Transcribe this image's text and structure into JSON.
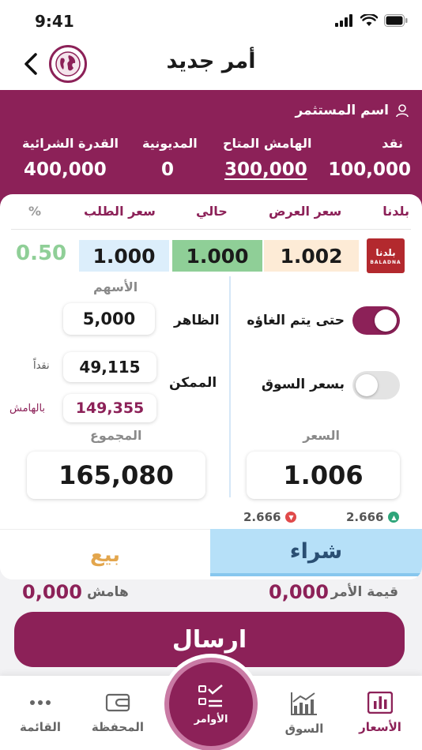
{
  "status_bar": {
    "time": "9:41"
  },
  "header": {
    "title": "أمر جديد"
  },
  "investor": {
    "name_label": "اسم المستثمر",
    "cash_label": "نقد",
    "cash_value": "100,000",
    "margin_available_label": "الهامش المتاح",
    "margin_available_value": "300,000",
    "debt_label": "المديونية",
    "debt_value": "0",
    "purchasing_power_label": "القدرة الشرائية",
    "purchasing_power_value": "400,000"
  },
  "quote": {
    "columns": {
      "stock": "بلدنا",
      "ask": "سعر العرض",
      "current": "حالي",
      "bid": "سعر الطلب",
      "percent": "%"
    },
    "stock_logo_ar": "بلدنا",
    "stock_logo_en": "BALADNA",
    "ask_price": "1.002",
    "current_price": "1.000",
    "bid_price": "1.000",
    "change_percent": "0.50"
  },
  "order": {
    "until_cancel_label": "حتى يتم الغاؤه",
    "until_cancel_on": true,
    "market_price_label": "بسعر السوق",
    "market_price_on": false,
    "price_label": "السعر",
    "price_value": "1.006",
    "shares_label": "الأسهم",
    "visible_label": "الظاهر",
    "visible_value": "5,000",
    "possible_label": "الممكن",
    "cash_short_label": "نقداً",
    "possible_cash_value": "49,115",
    "margin_short_label": "بالهامش",
    "possible_margin_value": "149,355",
    "total_label": "المجموع",
    "total_value": "165,080",
    "range_up": "2.666",
    "range_down": "2.666"
  },
  "tabs": {
    "buy": "شراء",
    "sell": "بيع"
  },
  "summary": {
    "order_value_label": "قيمة الأمر",
    "order_value": "0,000",
    "margin_label": "هامش",
    "margin_value": "0,000"
  },
  "submit_label": "ارسال",
  "nav": {
    "prices": "الأسعار",
    "market": "السوق",
    "orders": "الأوامر",
    "portfolio": "المحفظة",
    "menu": "القائمة"
  },
  "colors": {
    "brand": "#8c2158",
    "buy_tab": "#b6e0f8",
    "sell_text": "#e3a64d",
    "positive": "#8fcf97",
    "current_price_bg": "#8fcf97",
    "ask_price_bg": "#fdebd6",
    "bid_price_bg": "#dceefb"
  }
}
